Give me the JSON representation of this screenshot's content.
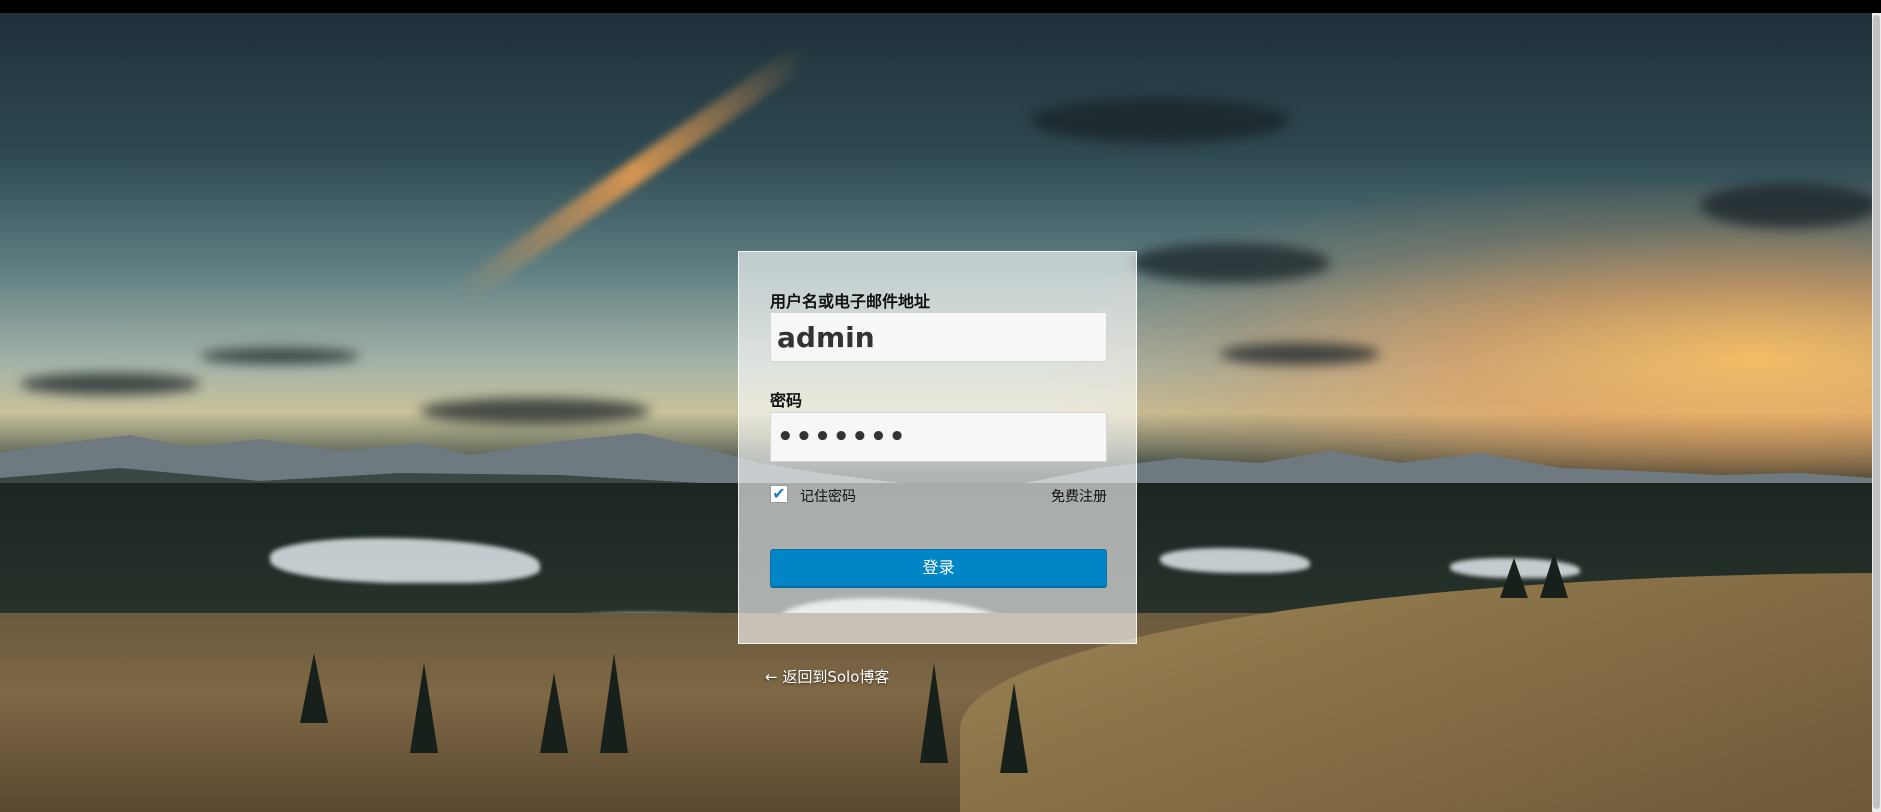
{
  "login": {
    "username_label": "用户名或电子邮件地址",
    "username_value": "admin",
    "password_label": "密码",
    "password_value": "•••••••",
    "remember_label": "记住密码",
    "remember_checked": true,
    "check_mark": "✔",
    "register_label": "免费注册",
    "submit_label": "登录"
  },
  "footer": {
    "back_label": "← 返回到Solo博客"
  },
  "colors": {
    "button": "#0085c6",
    "checkbox_mark": "#1e7fc0"
  }
}
